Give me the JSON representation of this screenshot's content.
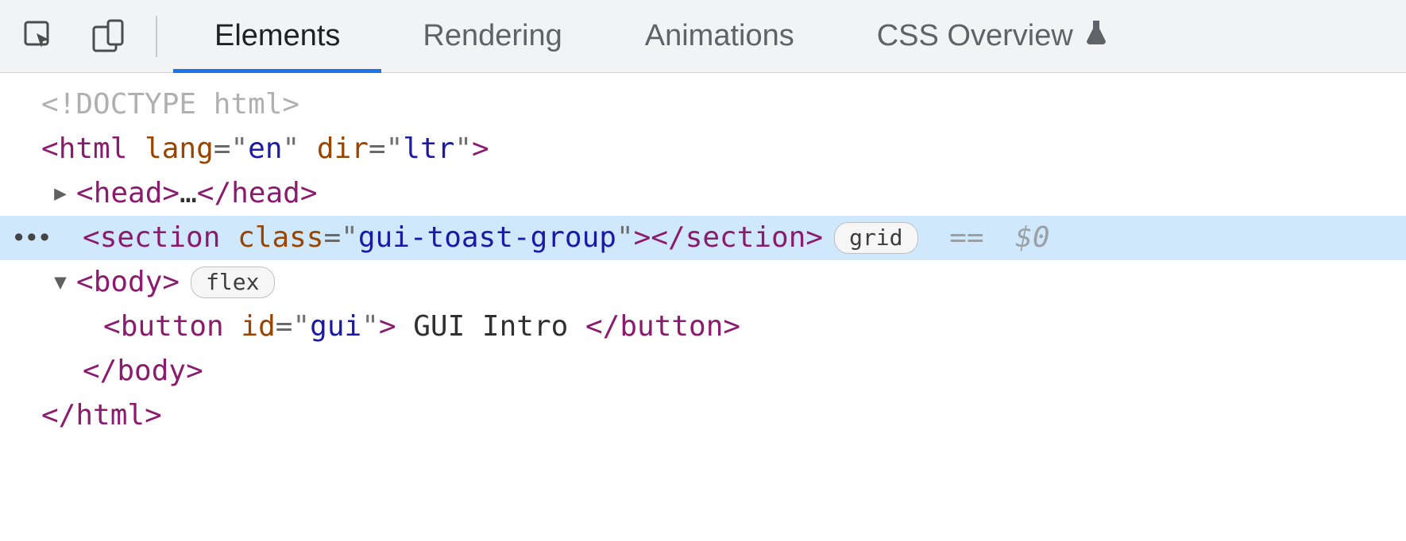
{
  "toolbar": {
    "tabs": [
      {
        "label": "Elements",
        "active": true
      },
      {
        "label": "Rendering",
        "active": false
      },
      {
        "label": "Animations",
        "active": false
      },
      {
        "label": "CSS Overview",
        "active": false,
        "hasFlask": true
      }
    ]
  },
  "tree": {
    "doctype": "<!DOCTYPE html>",
    "html": {
      "tag": "html",
      "attrs": [
        {
          "name": "lang",
          "value": "en"
        },
        {
          "name": "dir",
          "value": "ltr"
        }
      ]
    },
    "head": {
      "tag": "head",
      "ellipsis": "…"
    },
    "section": {
      "tag": "section",
      "attrs": [
        {
          "name": "class",
          "value": "gui-toast-group"
        }
      ],
      "badge": "grid",
      "console_ref": "== $0"
    },
    "body_open": {
      "tag": "body",
      "badge": "flex"
    },
    "button": {
      "tag": "button",
      "attrs": [
        {
          "name": "id",
          "value": "gui"
        }
      ],
      "text": " GUI Intro "
    },
    "body_close": {
      "tag": "body"
    },
    "html_close": {
      "tag": "html"
    }
  }
}
